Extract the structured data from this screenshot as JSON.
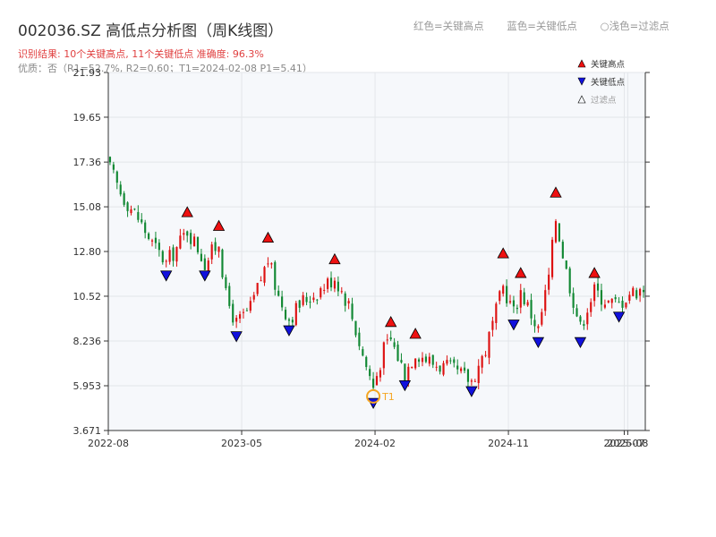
{
  "header": {
    "title": "002036.SZ 高低点分析图（周K线图）",
    "result_text": "识别结果: 10个关键高点, 11个关键低点  准确度: 96.3%",
    "quality_text": "优质：否（R1=52.7%, R2=0.60；T1=2024-02-08 P1=5.41）"
  },
  "top_legend": {
    "red": "红色=关键高点",
    "blue": "蓝色=关键低点",
    "light": "○浅色=过滤点"
  },
  "legend": {
    "high": "关键高点",
    "low": "关键低点",
    "filtered": "过滤点"
  },
  "colors": {
    "up": "#dd1111",
    "down": "#118833",
    "high_marker": "#ee1111",
    "low_marker": "#1111dd",
    "t1": "#f5a623"
  },
  "chart_data": {
    "type": "candlestick",
    "title": "002036.SZ 高低点分析图（周K线图）",
    "ylim": [
      3.671,
      21.93
    ],
    "y_ticks": [
      "3.671",
      "5.953",
      "8.236",
      "10.52",
      "12.80",
      "15.08",
      "17.36",
      "19.65",
      "21.93"
    ],
    "x_ticks": [
      "2022-08",
      "2023-05",
      "2024-02",
      "2024-11",
      "2025-07",
      "2025-08"
    ],
    "x_tick_positions": [
      0,
      38,
      76,
      114,
      147,
      148
    ],
    "n_weeks": 153,
    "highs": [
      {
        "week": 22,
        "price": 14.3
      },
      {
        "week": 31,
        "price": 13.6
      },
      {
        "week": 45,
        "price": 13.0
      },
      {
        "week": 64,
        "price": 11.9
      },
      {
        "week": 80,
        "price": 8.7
      },
      {
        "week": 87,
        "price": 8.1
      },
      {
        "week": 112,
        "price": 12.2
      },
      {
        "week": 117,
        "price": 11.2
      },
      {
        "week": 127,
        "price": 15.3
      },
      {
        "week": 138,
        "price": 11.2
      }
    ],
    "lows": [
      {
        "week": 16,
        "price": 11.9
      },
      {
        "week": 27,
        "price": 11.9
      },
      {
        "week": 36,
        "price": 8.8
      },
      {
        "week": 51,
        "price": 9.1
      },
      {
        "week": 75,
        "price": 5.4
      },
      {
        "week": 84,
        "price": 6.3
      },
      {
        "week": 103,
        "price": 6.0
      },
      {
        "week": 115,
        "price": 9.4
      },
      {
        "week": 122,
        "price": 8.5
      },
      {
        "week": 134,
        "price": 8.5
      },
      {
        "week": 145,
        "price": 9.8
      }
    ],
    "t1": {
      "label": "T1",
      "date": "2024-02-08",
      "price": 5.41,
      "week": 75
    },
    "candles": []
  }
}
